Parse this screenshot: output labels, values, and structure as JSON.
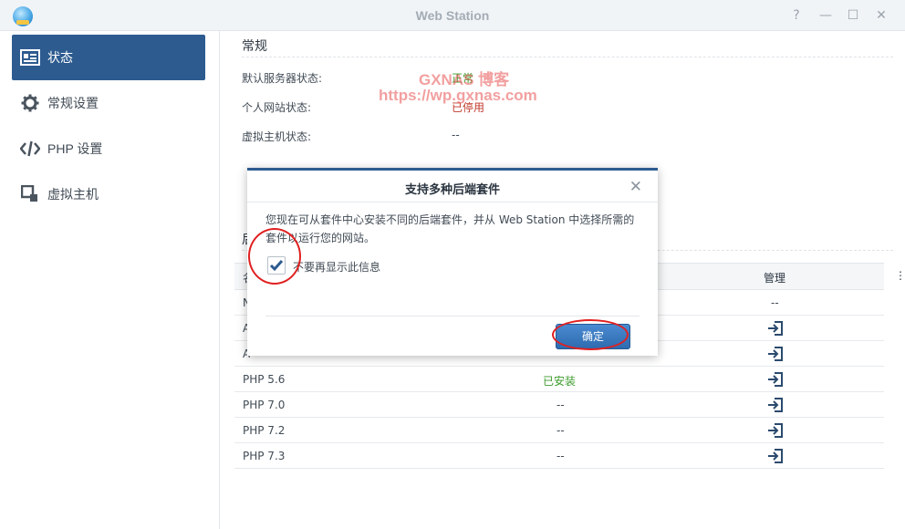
{
  "window": {
    "title": "Web Station",
    "controls": [
      {
        "name": "help",
        "glyph": "?"
      },
      {
        "name": "minimize",
        "glyph": "—"
      },
      {
        "name": "maximize",
        "glyph": "☐"
      },
      {
        "name": "close",
        "glyph": "✕"
      }
    ]
  },
  "sidebar": {
    "items": [
      {
        "label": "状态",
        "icon": "status-card-icon",
        "active": true
      },
      {
        "label": "常规设置",
        "icon": "gear-icon",
        "active": false
      },
      {
        "label": "PHP 设置",
        "icon": "code-icon",
        "active": false
      },
      {
        "label": "虚拟主机",
        "icon": "virtual-host-icon",
        "active": false
      }
    ]
  },
  "general": {
    "title": "常规",
    "rows": [
      {
        "label": "默认服务器状态:",
        "value": "正常",
        "color": "#3c9b2c"
      },
      {
        "label": "个人网站状态:",
        "value": "已停用",
        "color": "#c0392b"
      },
      {
        "label": "虚拟主机状态:",
        "value": "--",
        "color": "#414b55"
      }
    ]
  },
  "backend": {
    "title_partial": "后",
    "header": {
      "col_partial": "名",
      "manage": "管理",
      "menu": "⋮"
    },
    "rows": [
      {
        "name_partial": "N",
        "status": "",
        "manage": "--"
      },
      {
        "name_partial": "A",
        "status": "",
        "manage": "icon"
      },
      {
        "name_partial": "A",
        "status": "",
        "manage": "icon"
      },
      {
        "name": "PHP 5.6",
        "status": "已安装",
        "manage": "icon"
      },
      {
        "name": "PHP 7.0",
        "status": "--",
        "manage": "icon"
      },
      {
        "name": "PHP 7.2",
        "status": "--",
        "manage": "icon"
      },
      {
        "name": "PHP 7.3",
        "status": "--",
        "manage": "icon"
      }
    ]
  },
  "watermark": {
    "line1": "GXNAS 博客",
    "line2": "https://wp.gxnas.com"
  },
  "dialog": {
    "title": "支持多种后端套件",
    "message": "您现在可从套件中心安装不同的后端套件，并从 Web Station 中选择所需的套件以运行您的网站。",
    "checkbox_label": "不要再显示此信息",
    "checkbox_checked": true,
    "ok_label": "确定"
  },
  "colors": {
    "accent": "#2d5b8f",
    "status_ok": "#3c9b2c",
    "status_disabled": "#c0392b",
    "annotation": "#e02020"
  }
}
